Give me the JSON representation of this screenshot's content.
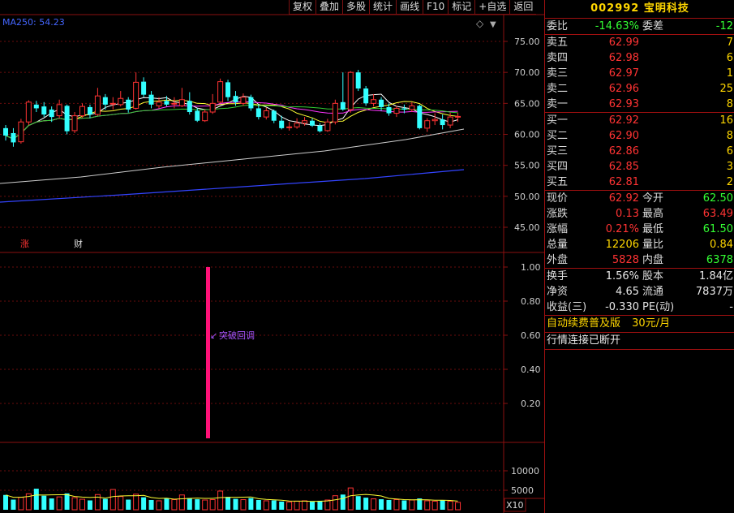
{
  "toolbar": {
    "buttons": [
      "复权",
      "叠加",
      "多股",
      "统计",
      "画线",
      "F10",
      "标记",
      "+自选",
      "返回"
    ]
  },
  "chart": {
    "ma_label": "MA250: 54.23",
    "price_ticks": [
      "75.00",
      "70.00",
      "65.00",
      "60.00",
      "55.00",
      "50.00",
      "45.00"
    ],
    "indicator_ticks": [
      "1.00",
      "0.80",
      "0.60",
      "0.40",
      "0.20"
    ],
    "volume_ticks": [
      "10000",
      "5000"
    ],
    "volume_unit": "X10",
    "annotation": "突破回调",
    "badge_zhang": "涨",
    "badge_cai": "财",
    "indicator_value": 1.0
  },
  "quote": {
    "code": "002992",
    "name": "宝明科技",
    "weibi_label": "委比",
    "weibi": "-14.63%",
    "weicha_label": "委差",
    "weicha": "-12",
    "asks": [
      {
        "label": "卖五",
        "price": "62.99",
        "vol": "7"
      },
      {
        "label": "卖四",
        "price": "62.98",
        "vol": "6"
      },
      {
        "label": "卖三",
        "price": "62.97",
        "vol": "1"
      },
      {
        "label": "卖二",
        "price": "62.96",
        "vol": "25"
      },
      {
        "label": "卖一",
        "price": "62.93",
        "vol": "8"
      }
    ],
    "bids": [
      {
        "label": "买一",
        "price": "62.92",
        "vol": "16"
      },
      {
        "label": "买二",
        "price": "62.90",
        "vol": "8"
      },
      {
        "label": "买三",
        "price": "62.86",
        "vol": "6"
      },
      {
        "label": "买四",
        "price": "62.85",
        "vol": "3"
      },
      {
        "label": "买五",
        "price": "62.81",
        "vol": "2"
      }
    ],
    "stats": [
      {
        "l1": "现价",
        "v1": "62.92",
        "c1": "red",
        "l2": "今开",
        "v2": "62.50",
        "c2": "green"
      },
      {
        "l1": "涨跌",
        "v1": "0.13",
        "c1": "red",
        "l2": "最高",
        "v2": "63.49",
        "c2": "red"
      },
      {
        "l1": "涨幅",
        "v1": "0.21%",
        "c1": "red",
        "l2": "最低",
        "v2": "61.50",
        "c2": "green"
      },
      {
        "l1": "总量",
        "v1": "12206",
        "c1": "yellow",
        "l2": "量比",
        "v2": "0.84",
        "c2": "yellow"
      },
      {
        "l1": "外盘",
        "v1": "5828",
        "c1": "red",
        "l2": "内盘",
        "v2": "6378",
        "c2": "green"
      }
    ],
    "fin": [
      {
        "l1": "换手",
        "v1": "1.56%",
        "l2": "股本",
        "v2": "1.84亿"
      },
      {
        "l1": "净资",
        "v1": "4.65",
        "l2": "流通",
        "v2": "7837万"
      },
      {
        "l1": "收益(三)",
        "v1": "-0.330",
        "l2": "PE(动)",
        "v2": "-"
      }
    ],
    "promo_text": "自动续费普及版",
    "promo_price": "30元/月",
    "status": "行情连接已断开"
  },
  "colors": {
    "up": "#ff3333",
    "down": "#33ffff",
    "grid": "#7a1010",
    "ma250": "#3333ff",
    "ma60": "#cccccc",
    "indicator": "#ff1177",
    "annotation": "#aa55ff"
  }
}
